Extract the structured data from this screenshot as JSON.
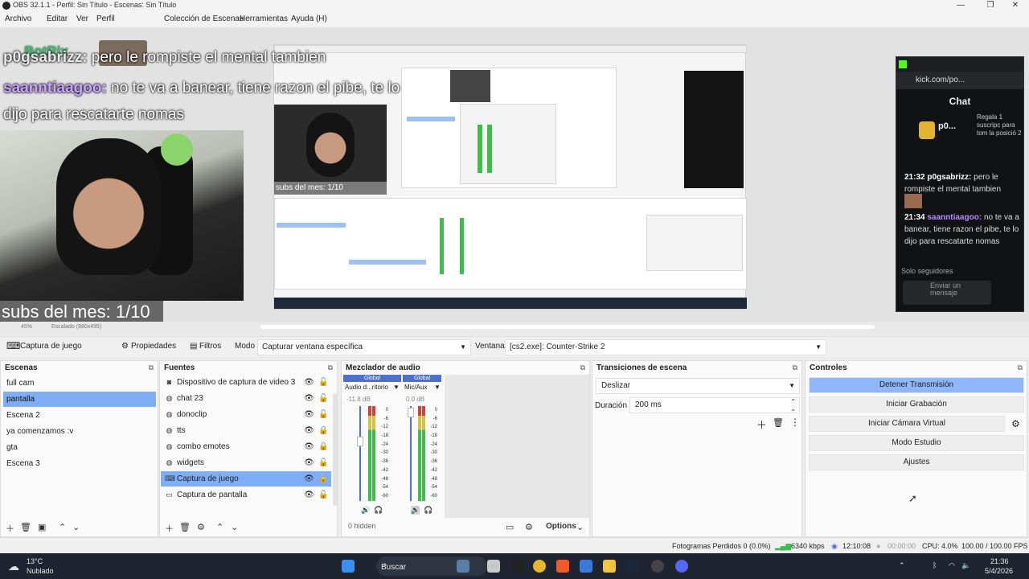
{
  "window": {
    "title": "OBS 32.1.1 - Perfil: Sin Título - Escenas: Sin Título",
    "minimize": "—",
    "maximize": "❐",
    "close": "✕"
  },
  "menu": {
    "items": [
      "Archivo",
      "Editar",
      "Ver",
      "Perfil",
      "Colección de Escenas",
      "Herramientas",
      "Ayuda (H)"
    ]
  },
  "overlay": {
    "botrix": "BotRix",
    "chat": [
      {
        "user": "p0gsabrizz:",
        "text": " pero le rompiste el mental tambien"
      },
      {
        "user": "saanntiaagoo:",
        "text": " no te va a banear, tiene razon el pibe, te lo"
      },
      {
        "user": "",
        "text": "dijo para rescatarte nomas"
      }
    ],
    "subs": "subs del mes: 1/10",
    "capture_subs": "subs del mes: 1/10"
  },
  "kick_chat": {
    "url": "kick.com/po...",
    "header": "Chat",
    "gift_user": "p0...",
    "gift_text": "Regala 1 suscripc para tom la posició 2",
    "messages": [
      {
        "time": "21:32",
        "user": "p0gsabrizz:",
        "text": "pero le rompiste el mental tambien"
      },
      {
        "time": "21:34",
        "user": "saanntiaagoo:",
        "text": "no te va a banear, tiene razon el pibe, te lo dijo para rescatarte nomas"
      }
    ],
    "followers_only": "Solo seguidores",
    "input_placeholder": "Enviar un mensaje"
  },
  "preview_status": {
    "zoom": "45%",
    "scale": "Escalado (880x495)"
  },
  "source_toolbar": {
    "source_name": "Captura de juego",
    "properties": "Propiedades",
    "filters": "Filtros",
    "mode_label": "Modo",
    "mode_value": "Capturar ventana específica",
    "window_label": "Ventana",
    "window_value": "[cs2.exe]: Counter-Strike 2"
  },
  "scenes": {
    "title": "Escenas",
    "items": [
      "full cam",
      "pantalla",
      "Escena 2",
      "ya comenzamos :v",
      "gta",
      "Escena 3"
    ],
    "selected_index": 1
  },
  "sources": {
    "title": "Fuentes",
    "items": [
      {
        "name": "Dispositivo de captura de video 3",
        "icon": "camera-icon",
        "glyph": "◙",
        "locked": false
      },
      {
        "name": "chat 23",
        "icon": "globe-icon",
        "glyph": "◍",
        "locked": false
      },
      {
        "name": "donoclip",
        "icon": "globe-icon",
        "glyph": "◍",
        "locked": false
      },
      {
        "name": "tts",
        "icon": "globe-icon",
        "glyph": "◍",
        "locked": true
      },
      {
        "name": "combo emotes",
        "icon": "globe-icon",
        "glyph": "◍",
        "locked": true
      },
      {
        "name": "widgets",
        "icon": "globe-icon",
        "glyph": "◍",
        "locked": false
      },
      {
        "name": "Captura de juego",
        "icon": "gamepad-icon",
        "glyph": "⌨",
        "locked": true
      },
      {
        "name": "Captura de pantalla",
        "icon": "monitor-icon",
        "glyph": "▭",
        "locked": false
      }
    ],
    "selected_index": 6
  },
  "mixer": {
    "title": "Mezclador de audio",
    "channels": [
      {
        "scope": "Global",
        "name": "Audio d...ritorio",
        "db": "-11.8 dB",
        "level": 0.45
      },
      {
        "scope": "Global",
        "name": "Mic/Aux",
        "db": "0.0 dB",
        "level": 0.0
      }
    ],
    "scale": [
      "0",
      "-6",
      "-12",
      "-18",
      "-24",
      "-30",
      "-36",
      "-42",
      "-48",
      "-54",
      "-60"
    ],
    "hidden": "0 hidden",
    "options": "Options"
  },
  "transitions": {
    "title": "Transiciones de escena",
    "type": "Deslizar",
    "duration_label": "Duración",
    "duration_value": "200 ms"
  },
  "controls": {
    "title": "Controles",
    "buttons": [
      "Detener Transmisión",
      "Iniciar Grabación",
      "Iniciar Cámara Virtual",
      "Modo Estudio",
      "Ajustes"
    ]
  },
  "statusbar": {
    "dropped": "Fotogramas Perdidos 0 (0.0%)",
    "bitrate": "6340 kbps",
    "stream_time": "12:10:08",
    "rec_time": "00:00:00",
    "cpu": "CPU: 4.0%",
    "fps": "100.00 / 100.00 FPS"
  },
  "taskbar": {
    "temp": "13°C",
    "weather": "Nublado",
    "search": "Buscar",
    "time": "21:36",
    "date": "5/4/2026"
  },
  "colors": {
    "accent": "#7faef7",
    "kick_green": "#53fc18",
    "botrix_green": "#3ac46d",
    "username_purple": "#b48cff"
  }
}
